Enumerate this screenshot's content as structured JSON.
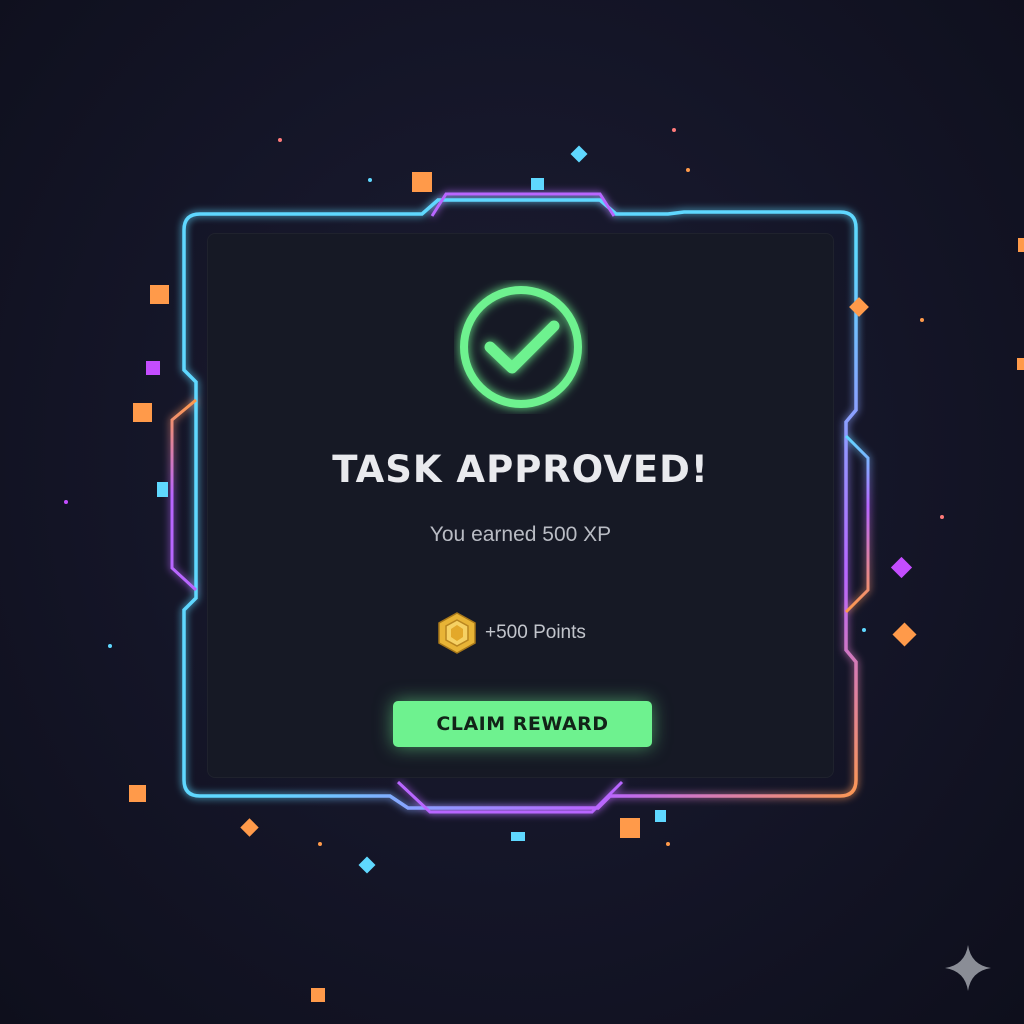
{
  "dialog": {
    "status_icon": "check-circle-icon",
    "title": "TASK APPROVED!",
    "subtitle": "You earned 500 XP",
    "reward_icon": "hexagon-coin-icon",
    "reward_text": "+500 Points",
    "claim_label": "CLAIM REWARD"
  },
  "colors": {
    "background": "#141527",
    "dialog_background": "#161925",
    "frame_cyan": "#5fd8ff",
    "frame_purple": "#b866ff",
    "frame_orange": "#ff9a4a",
    "success_green": "#6ef28f",
    "coin_gold": "#e8b436"
  },
  "decoration": {
    "corner_icon": "sparkle-icon"
  }
}
